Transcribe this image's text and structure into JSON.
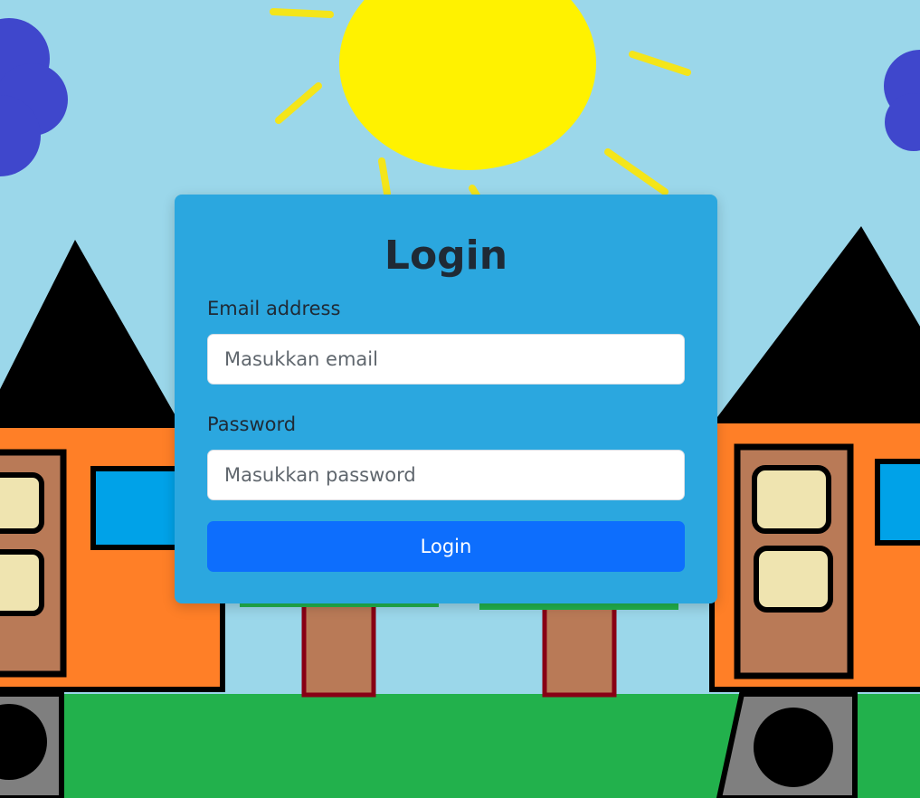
{
  "page": {
    "background_name": "houses-sun-drawing-background"
  },
  "login_form": {
    "title": "Login",
    "email_label": "Email address",
    "email_placeholder": "Masukkan email",
    "email_value": "",
    "password_label": "Password",
    "password_placeholder": "Masukkan password",
    "password_value": "",
    "submit_label": "Login"
  },
  "colors": {
    "sky": "#9bd7ea",
    "sun": "#fff200",
    "cloud": "#3f47cc",
    "card": "#2ba7df",
    "button": "#0d6efd",
    "grass": "#22b14c",
    "house_wall": "#ff7f27",
    "roof": "#000000"
  }
}
